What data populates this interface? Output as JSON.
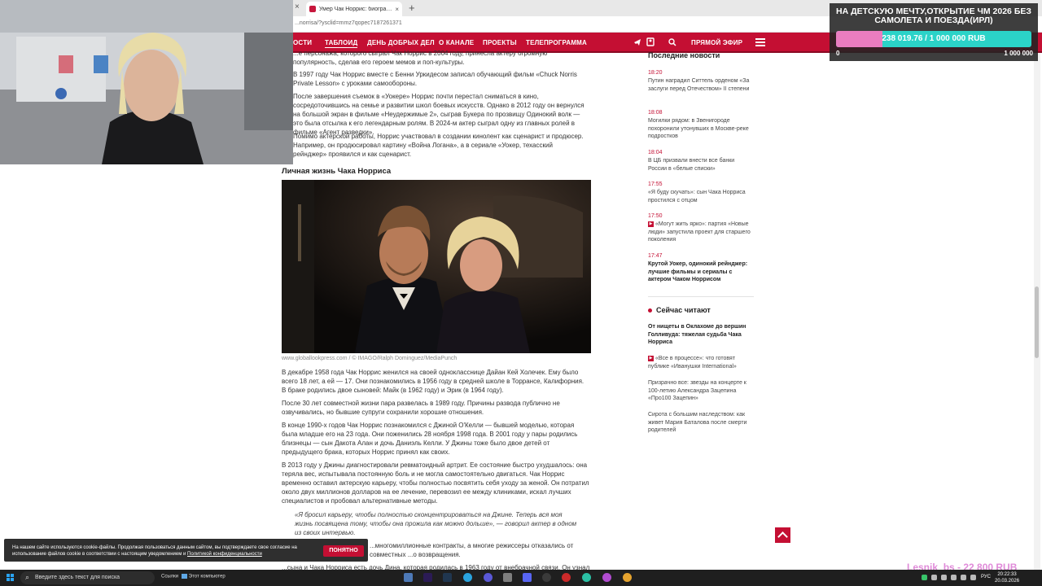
{
  "browser": {
    "inactive_tab_close": "×",
    "active_tab_title": "Умер Чак Норрис: биография ак",
    "active_tab_close": "×",
    "new_tab": "+",
    "url": "...norrisa/?ysclid=mmz7qopec7187261371"
  },
  "nav": {
    "items": [
      "ОСТИ",
      "ТАБЛОИД",
      "ДЕНЬ ДОБРЫХ ДЕЛ",
      "О КАНАЛЕ",
      "ПРОЕКТЫ",
      "ТЕЛЕПРОГРАММА"
    ],
    "live_label": "ПРЯМОЙ ЭФИР",
    "icons": [
      "vk-icon",
      "telegram-icon",
      "ok-icon",
      "search-icon",
      "menu-icon"
    ]
  },
  "article": {
    "p1": "...е персонажа, которого сыграл Чак Норрис в 2004 году, принесла актеру огромную популярность, сделав его героем мемов и поп-культуры.",
    "p2": "В 1997 году Чак Норрис вместе с Бенни Уркидесом записал обучающий фильм «Chuck Norris Private Lesson» с уроками самообороны.",
    "p3": "После завершения съемок в «Уокере» Норрис почти перестал сниматься в кино, сосредоточившись на семье и развитии школ боевых искусств. Однако в 2012 году он вернулся на большой экран в фильме «Неудержимые 2», сыграв Букера по прозвищу Одинокий волк — это была отсылка к его легендарным ролям. В 2024-м актер сыграл одну из главных ролей в фильме «Агент разведки».",
    "p4": "Помимо актерской работы, Норрис участвовал в создании кинолент как сценарист и продюсер. Например, он продюсировал картину «Война Логана», а в сериале «Уокер, техасский рейнджер» проявился и как сценарист.",
    "section_heading": "Личная жизнь Чака Норриса",
    "photo_caption": "www.globallookpress.com / © IMAGO/Ralph Dominguez/MediaPunch",
    "p5": "В декабре 1958 года Чак Норрис женился на своей однокласснице Дайан Кей Холечек. Ему было всего 18 лет, а ей — 17. Они познакомились в 1956 году в средней школе в Торрансе, Калифорния. В браке родились двое сыновей: Майк (в 1962 году) и Эрик (в 1964 году).",
    "p6": "После 30 лет совместной жизни пара развелась в 1989 году. Причины развода публично не озвучивались, но бывшие супруги сохранили хорошие отношения.",
    "p7": "В конце 1990-х годов Чак Норрис познакомился с Джиной О'Келли — бывшей моделью, которая была младше его на 23 года. Они поженились 28 ноября 1998 года. В 2001 году у пары родились близнецы — сын Дакота Алан и дочь Даниэль Келли. У Джины тоже было двое детей от предыдущего брака, которых Норрис принял как своих.",
    "p8": "В 2013 году у Джины диагностировали ревматоидный артрит. Ее состояние быстро ухудшалось: она теряла вес, испытывала постоянную боль и не могла самостоятельно двигаться. Чак Норрис временно оставил актерскую карьеру, чтобы полностью посвятить себя уходу за женой. Он потратил около двух миллионов долларов на ее лечение, перевозил ее между клиниками, искал лучших специалистов и пробовал альтернативные методы.",
    "quote": "«Я бросил карьеру, чтобы полностью сконцентрироваться на Джине. Теперь вся моя жизнь посвящена тому, чтобы она прожила как можно дольше», — говорил актер в одном из своих интервью.",
    "p9": "...многомиллионные контракты, а многие режиссеры отказались от совместных ...о возвращения.",
    "p10": "...сына и Чака Норриса есть дочь Дина, которая родилась в 1963 году от внебрачной связи. Он узнал о"
  },
  "sidebar": {
    "latest_heading": "Последние новости",
    "latest": [
      {
        "time": "18:20",
        "text": "Путин наградил Ситтель орденом «За заслуги перед Отечеством» II степени",
        "bold": false,
        "badge": false
      },
      {
        "time": "18:08",
        "text": "Могилки рядом: в Звенигороде похоронили утонувших в Москве-реке подростков",
        "bold": false,
        "badge": false
      },
      {
        "time": "18:04",
        "text": "В ЦБ призвали внести все банки России в «белые списки»",
        "bold": false,
        "badge": false
      },
      {
        "time": "17:55",
        "text": "«Я буду скучать»: сын Чака Норриса простился с отцом",
        "bold": false,
        "badge": false
      },
      {
        "time": "17:50",
        "text": "«Могут жить ярко»: партия «Новые люди» запустила проект для старшего поколения",
        "bold": false,
        "badge": true
      },
      {
        "time": "17:47",
        "text": "Крутой Уокер, одинокий рейнджер: лучшие фильмы и сериалы с актером Чаком Норрисом",
        "bold": true,
        "badge": false
      }
    ],
    "reading_heading": "Сейчас читают",
    "reading": [
      {
        "text": "От нищеты в Оклахоме до вершин Голливуда: тяжелая судьба Чака Норриса",
        "bold": true,
        "badge": false
      },
      {
        "text": "«Все в процессе»: что готовят публике «Иванушки International»",
        "bold": false,
        "badge": true
      },
      {
        "text": "Призрачно все: звезды на концерте к 100-летию Александра Зацепина «Про100 Зацепин»",
        "bold": false,
        "badge": false
      },
      {
        "text": "Сирота с большим наследством: как живет Мария Баталова после смерти родителей",
        "bold": false,
        "badge": false
      }
    ]
  },
  "donation": {
    "title": "НА ДЕТСКУЮ МЕЧТУ,ОТКРЫТИЕ ЧМ 2026 БЕЗ САМОЛЕТА И ПОЕЗДА(ИРЛ)",
    "amount_text": "238 019.76 / 1 000 000 RUB",
    "progress": 0.238,
    "min_label": "0",
    "max_label": "1 000 000"
  },
  "cookie": {
    "text": "На нашем сайте используются cookie-файлы. Продолжая пользоваться данным сайтом, вы подтверждаете свое согласие на использование файлов cookie в соответствии с настоящим уведомлением и",
    "link": "Политикой конфиденциальности",
    "button": "ПОНЯТНО"
  },
  "overlay_watermark": "Lesnik_bs - 22 800 RUB",
  "taskbar": {
    "search_placeholder": "Введите здесь текст для поиска",
    "widget_label": "Ссылки",
    "widget_text": "Этот компьютер",
    "lang": "РУС",
    "time": "20:22:33",
    "date": "20.03.2026",
    "app_icons": [
      "file-explorer-icon",
      "premiere-icon",
      "steam-icon",
      "telegram-icon",
      "vpn-icon",
      "settings-icon",
      "discord-icon",
      "obs-icon",
      "edge-icon",
      "browser-icon",
      "chrome-icon"
    ]
  },
  "colors": {
    "brand": "#c40f33",
    "donation_fill": "#ea7dc0",
    "donation_track": "#2bd3c8"
  }
}
